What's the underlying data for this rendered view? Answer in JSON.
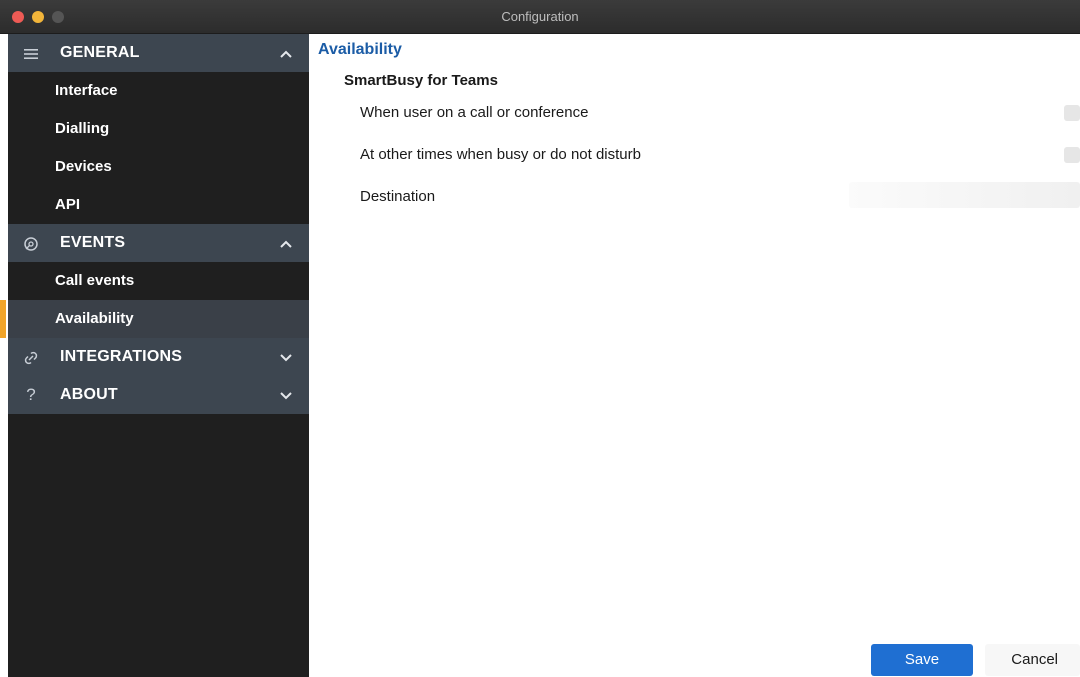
{
  "window": {
    "title": "Configuration"
  },
  "sidebar": {
    "sections": [
      {
        "label": "GENERAL",
        "icon": "menu-icon",
        "expanded": true,
        "items": [
          "Interface",
          "Dialling",
          "Devices",
          "API"
        ]
      },
      {
        "label": "EVENTS",
        "icon": "events-icon",
        "expanded": true,
        "items": [
          "Call events",
          "Availability"
        ]
      },
      {
        "label": "INTEGRATIONS",
        "icon": "link-icon",
        "expanded": false,
        "items": []
      },
      {
        "label": "ABOUT",
        "icon": "question-icon",
        "expanded": false,
        "items": []
      }
    ],
    "active_item": "Availability"
  },
  "main": {
    "page_title": "Availability",
    "group_title": "SmartBusy for Teams",
    "rows": [
      {
        "label": "When user on a call or conference"
      },
      {
        "label": "At other times when busy or do not disturb"
      },
      {
        "label": "Destination"
      }
    ]
  },
  "footer": {
    "save_label": "Save",
    "cancel_label": "Cancel"
  },
  "colors": {
    "accent": "#1f6fd2",
    "active_indicator": "#f1a428",
    "page_title": "#1b5ca6",
    "sidebar_bg": "#1f1f1f",
    "section_header_bg": "#3d4650"
  }
}
